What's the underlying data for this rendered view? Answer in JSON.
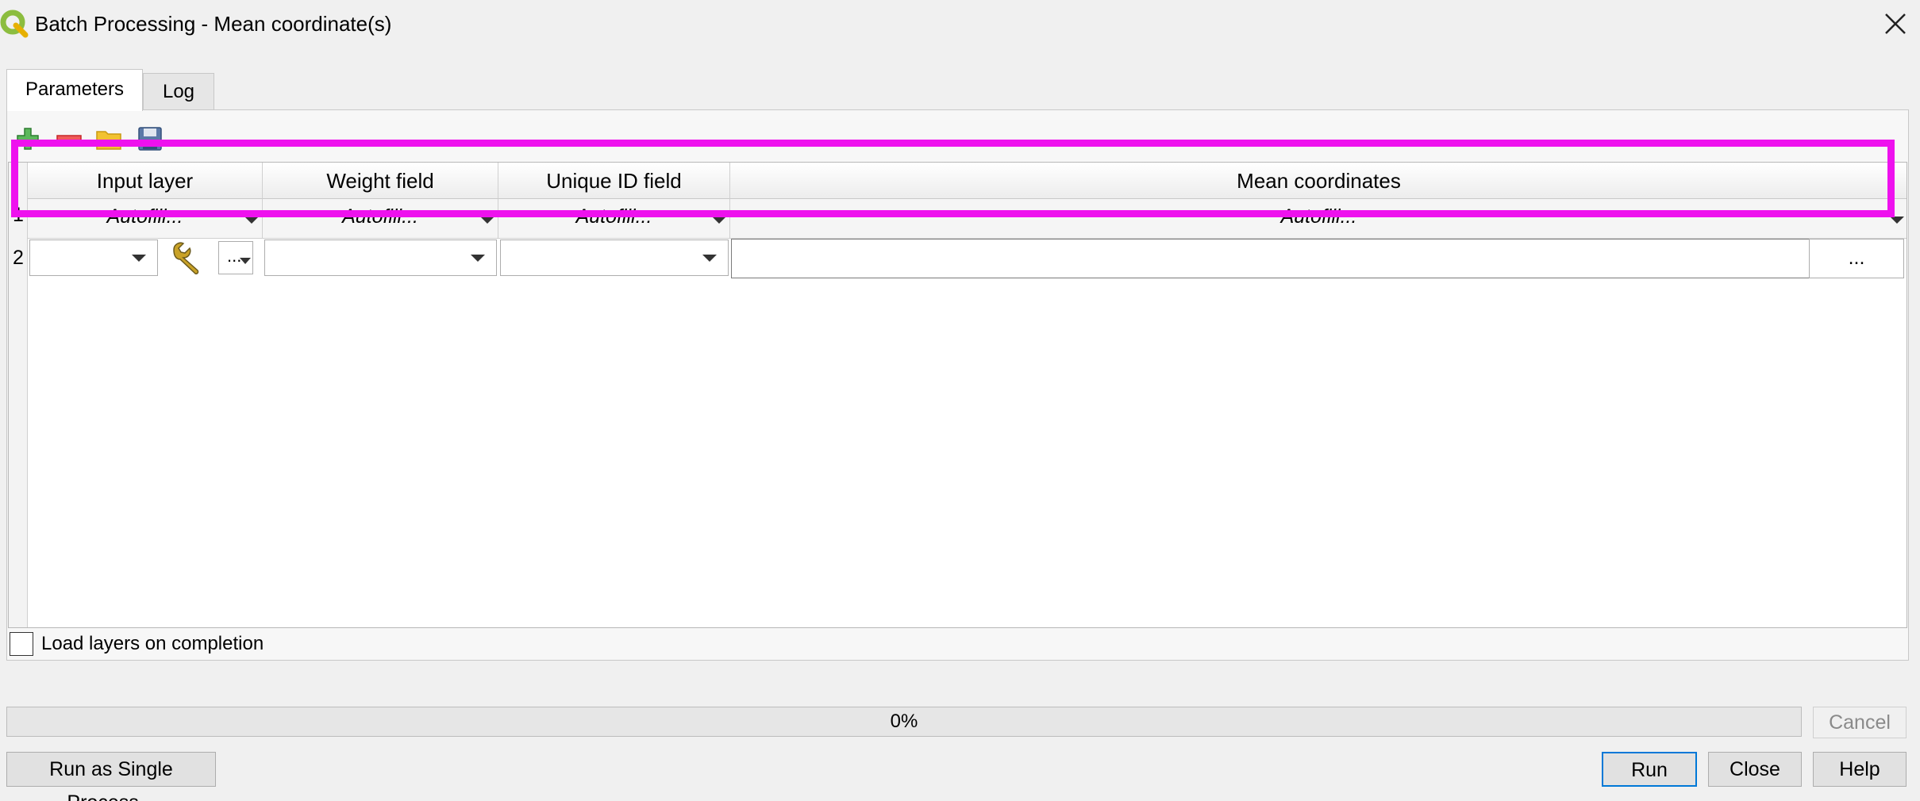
{
  "window": {
    "title": "Batch Processing - Mean coordinate(s)"
  },
  "tabs": [
    {
      "label": "Parameters",
      "active": true
    },
    {
      "label": "Log",
      "active": false
    }
  ],
  "toolbar": {
    "icons": [
      "add-row-icon",
      "remove-row-icon",
      "open-folder-icon",
      "save-icon"
    ]
  },
  "table": {
    "columns": [
      "Input layer",
      "Weight field",
      "Unique ID field",
      "Mean coordinates"
    ],
    "autofill_row": {
      "number": "1",
      "label": "Autofill..."
    },
    "data_row": {
      "number": "2",
      "ellipsis": "...",
      "browse": "..."
    }
  },
  "options": {
    "load_layers_label": "Load layers on completion",
    "load_layers_checked": false
  },
  "progress": {
    "value": 0,
    "label": "0%"
  },
  "buttons": {
    "cancel": "Cancel",
    "run_single": "Run as Single Process...",
    "run": "Run",
    "close": "Close",
    "help": "Help"
  },
  "colors": {
    "highlight": "#ee11ee",
    "qgis_green": "#8cbd3f"
  }
}
